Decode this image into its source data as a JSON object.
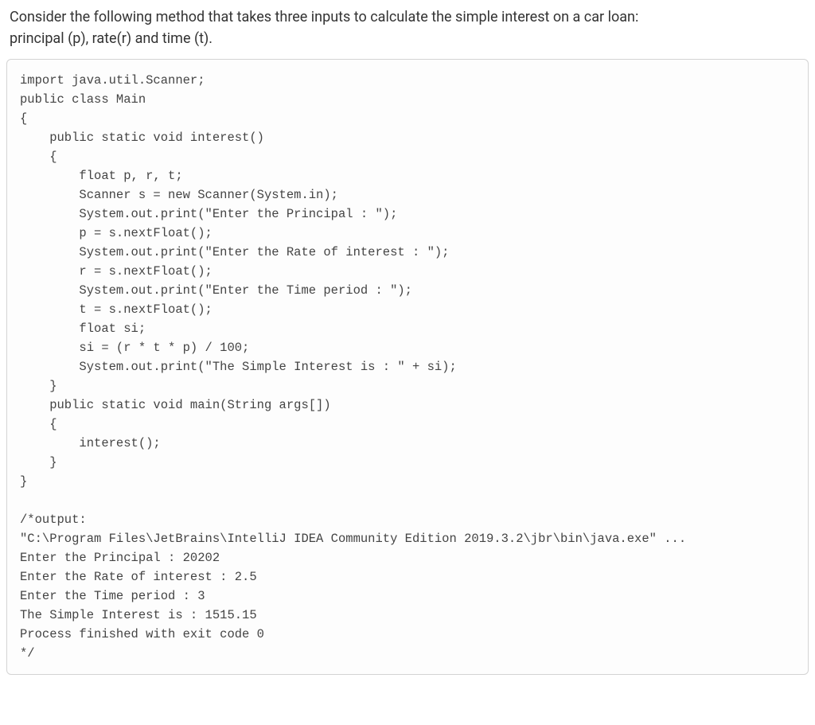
{
  "question": {
    "line1": "Consider the following method that takes three inputs to calculate the simple interest on a car loan:",
    "line2": "principal (p), rate(r) and time (t)."
  },
  "code": {
    "l01": "import java.util.Scanner;",
    "l02": "public class Main",
    "l03": "{",
    "l04": "    public static void interest()",
    "l05": "    {",
    "l06": "        float p, r, t;",
    "l07": "        Scanner s = new Scanner(System.in);",
    "l08": "        System.out.print(\"Enter the Principal : \");",
    "l09": "        p = s.nextFloat();",
    "l10": "        System.out.print(\"Enter the Rate of interest : \");",
    "l11": "        r = s.nextFloat();",
    "l12": "        System.out.print(\"Enter the Time period : \");",
    "l13": "        t = s.nextFloat();",
    "l14": "        float si;",
    "l15": "        si = (r * t * p) / 100;",
    "l16": "        System.out.print(\"The Simple Interest is : \" + si);",
    "l17": "    }",
    "l18": "    public static void main(String args[])",
    "l19": "    {",
    "l20": "        interest();",
    "l21": "    }",
    "l22": "}",
    "l23": "",
    "l24": "/*output:",
    "l25": "\"C:\\Program Files\\JetBrains\\IntelliJ IDEA Community Edition 2019.3.2\\jbr\\bin\\java.exe\" ...",
    "l26": "Enter the Principal : 20202",
    "l27": "Enter the Rate of interest : 2.5",
    "l28": "Enter the Time period : 3",
    "l29": "The Simple Interest is : 1515.15",
    "l30": "Process finished with exit code 0",
    "l31": "*/"
  }
}
